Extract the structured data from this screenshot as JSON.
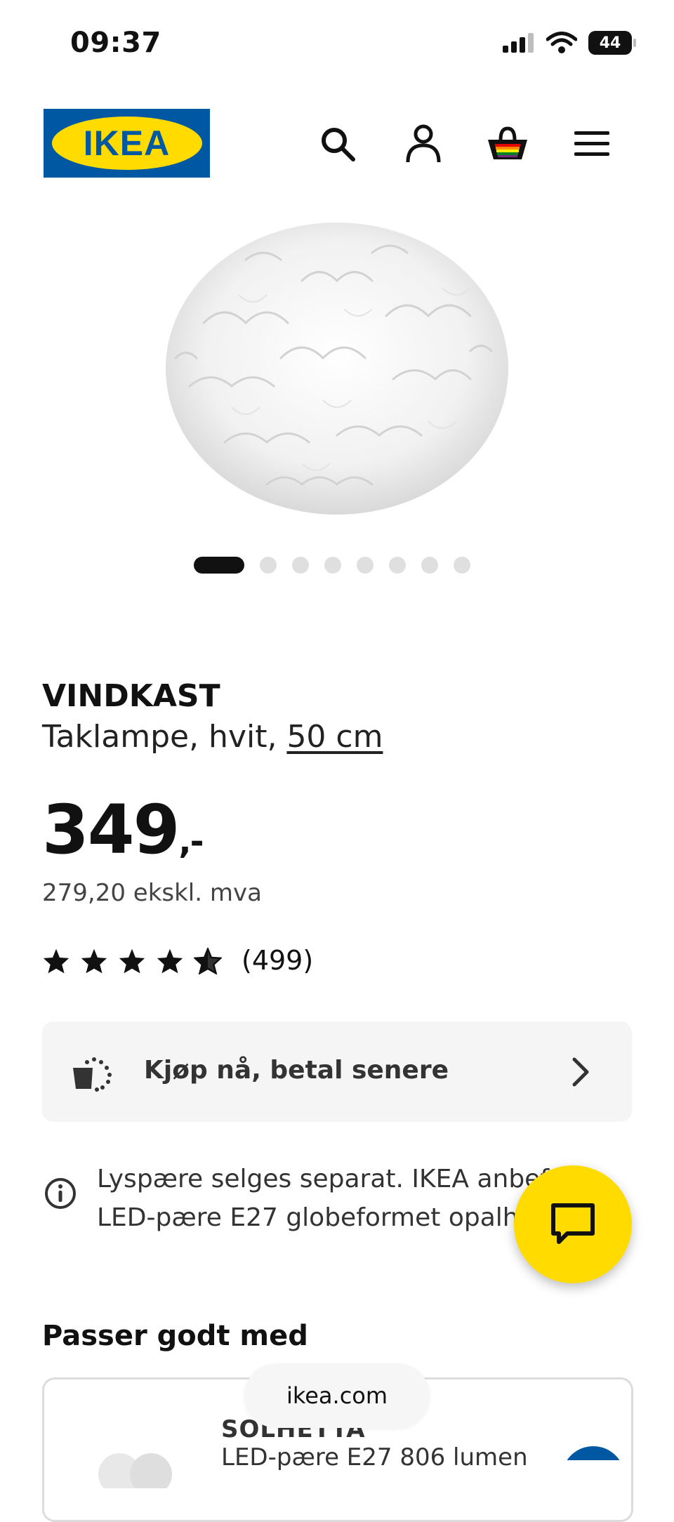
{
  "status_bar": {
    "time": "09:37",
    "battery": "44"
  },
  "header": {
    "logo_text": "IKEA",
    "icons": [
      "search-icon",
      "account-icon",
      "cart-icon",
      "menu-icon"
    ]
  },
  "gallery": {
    "image_count": 8,
    "active_index": 0
  },
  "product": {
    "name": "VINDKAST",
    "description": "Taklampe, hvit, ",
    "size_link": "50 cm",
    "price_main": "349",
    "price_suffix": ",-",
    "price_ex_vat": "279,20 ekskl. mva",
    "rating_stars": 4.5,
    "rating_max": 5,
    "review_count": "(499)"
  },
  "bnpl": {
    "label": "Kjøp nå, betal senere"
  },
  "info": {
    "text": "Lyspære selges separat. IKEA anbefaler LED-pære E27 globeformet opalhvit."
  },
  "recommendations": {
    "title": "Passer godt med",
    "items": [
      {
        "name": "SOLHETTA",
        "description": "LED-pære E27 806 lumen"
      }
    ]
  },
  "browser": {
    "url": "ikea.com"
  },
  "colors": {
    "ikea_blue": "#0058a3",
    "ikea_yellow": "#ffdb00"
  }
}
